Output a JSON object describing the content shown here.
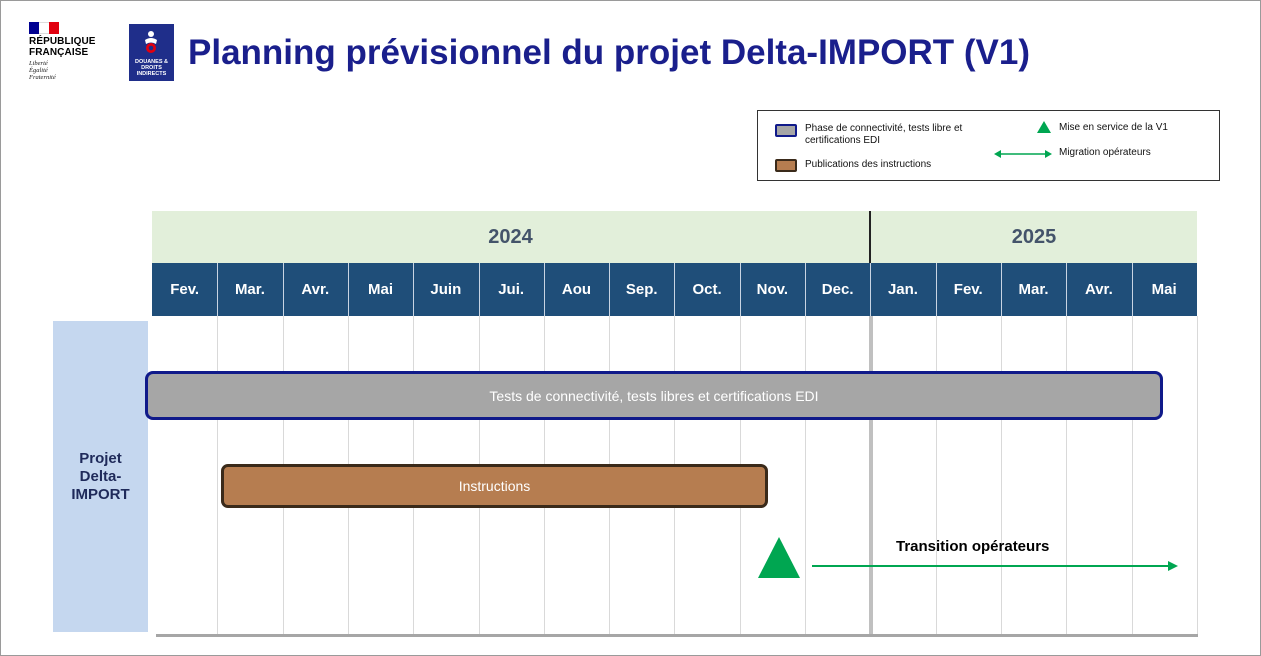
{
  "header": {
    "rf_title_line1": "RÉPUBLIQUE",
    "rf_title_line2": "FRANÇAISE",
    "rf_motto": [
      "Liberté",
      "Égalité",
      "Fraternité"
    ],
    "douanes_text": "DOUANES & DROITS INDIRECTS",
    "title": "Planning prévisionnel du projet Delta-IMPORT (V1)"
  },
  "legend": {
    "phase": "Phase de connectivité, tests libre et certifications EDI",
    "publications": "Publications des instructions",
    "mise_en_service": "Mise en service de la V1",
    "migration": "Migration opérateurs"
  },
  "timeline": {
    "years": [
      "2024",
      "2025"
    ],
    "months": [
      "Fev.",
      "Mar.",
      "Avr.",
      "Mai",
      "Juin",
      "Jui.",
      "Aou",
      "Sep.",
      "Oct.",
      "Nov.",
      "Dec.",
      "Jan.",
      "Fev.",
      "Mar.",
      "Avr.",
      "Mai"
    ]
  },
  "project": {
    "label": "Projet Delta-IMPORT",
    "bar_tests": "Tests de connectivité, tests libres et certifications EDI",
    "bar_instructions": "Instructions",
    "transition": "Transition opérateurs"
  },
  "colors": {
    "title": "#1a1f8c",
    "year_band": "#e2efda",
    "month_row": "#1f4e79",
    "tests_fill": "#a6a6a6",
    "tests_border": "#101a8a",
    "instr_fill": "#b67d50",
    "milestone": "#00a651",
    "project_label_bg": "#c5d7ef"
  }
}
